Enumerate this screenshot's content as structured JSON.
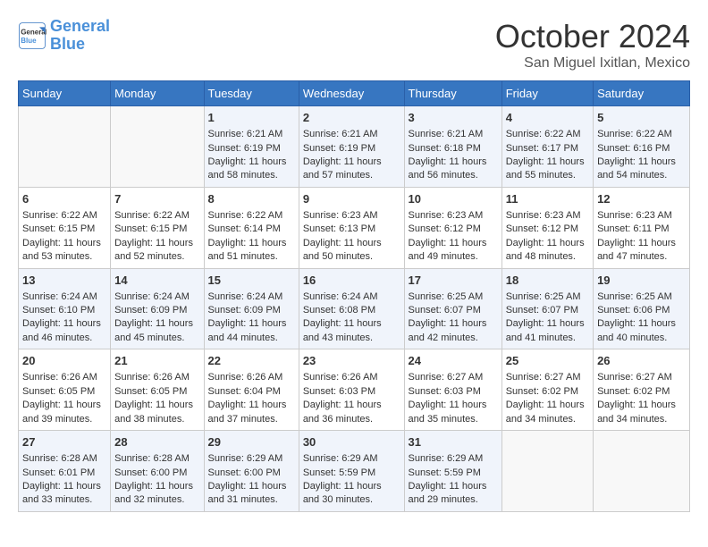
{
  "header": {
    "logo_line1": "General",
    "logo_line2": "Blue",
    "month": "October 2024",
    "location": "San Miguel Ixitlan, Mexico"
  },
  "weekdays": [
    "Sunday",
    "Monday",
    "Tuesday",
    "Wednesday",
    "Thursday",
    "Friday",
    "Saturday"
  ],
  "weeks": [
    [
      {
        "day": "",
        "sunrise": "",
        "sunset": "",
        "daylight": ""
      },
      {
        "day": "",
        "sunrise": "",
        "sunset": "",
        "daylight": ""
      },
      {
        "day": "1",
        "sunrise": "Sunrise: 6:21 AM",
        "sunset": "Sunset: 6:19 PM",
        "daylight": "Daylight: 11 hours and 58 minutes."
      },
      {
        "day": "2",
        "sunrise": "Sunrise: 6:21 AM",
        "sunset": "Sunset: 6:19 PM",
        "daylight": "Daylight: 11 hours and 57 minutes."
      },
      {
        "day": "3",
        "sunrise": "Sunrise: 6:21 AM",
        "sunset": "Sunset: 6:18 PM",
        "daylight": "Daylight: 11 hours and 56 minutes."
      },
      {
        "day": "4",
        "sunrise": "Sunrise: 6:22 AM",
        "sunset": "Sunset: 6:17 PM",
        "daylight": "Daylight: 11 hours and 55 minutes."
      },
      {
        "day": "5",
        "sunrise": "Sunrise: 6:22 AM",
        "sunset": "Sunset: 6:16 PM",
        "daylight": "Daylight: 11 hours and 54 minutes."
      }
    ],
    [
      {
        "day": "6",
        "sunrise": "Sunrise: 6:22 AM",
        "sunset": "Sunset: 6:15 PM",
        "daylight": "Daylight: 11 hours and 53 minutes."
      },
      {
        "day": "7",
        "sunrise": "Sunrise: 6:22 AM",
        "sunset": "Sunset: 6:15 PM",
        "daylight": "Daylight: 11 hours and 52 minutes."
      },
      {
        "day": "8",
        "sunrise": "Sunrise: 6:22 AM",
        "sunset": "Sunset: 6:14 PM",
        "daylight": "Daylight: 11 hours and 51 minutes."
      },
      {
        "day": "9",
        "sunrise": "Sunrise: 6:23 AM",
        "sunset": "Sunset: 6:13 PM",
        "daylight": "Daylight: 11 hours and 50 minutes."
      },
      {
        "day": "10",
        "sunrise": "Sunrise: 6:23 AM",
        "sunset": "Sunset: 6:12 PM",
        "daylight": "Daylight: 11 hours and 49 minutes."
      },
      {
        "day": "11",
        "sunrise": "Sunrise: 6:23 AM",
        "sunset": "Sunset: 6:12 PM",
        "daylight": "Daylight: 11 hours and 48 minutes."
      },
      {
        "day": "12",
        "sunrise": "Sunrise: 6:23 AM",
        "sunset": "Sunset: 6:11 PM",
        "daylight": "Daylight: 11 hours and 47 minutes."
      }
    ],
    [
      {
        "day": "13",
        "sunrise": "Sunrise: 6:24 AM",
        "sunset": "Sunset: 6:10 PM",
        "daylight": "Daylight: 11 hours and 46 minutes."
      },
      {
        "day": "14",
        "sunrise": "Sunrise: 6:24 AM",
        "sunset": "Sunset: 6:09 PM",
        "daylight": "Daylight: 11 hours and 45 minutes."
      },
      {
        "day": "15",
        "sunrise": "Sunrise: 6:24 AM",
        "sunset": "Sunset: 6:09 PM",
        "daylight": "Daylight: 11 hours and 44 minutes."
      },
      {
        "day": "16",
        "sunrise": "Sunrise: 6:24 AM",
        "sunset": "Sunset: 6:08 PM",
        "daylight": "Daylight: 11 hours and 43 minutes."
      },
      {
        "day": "17",
        "sunrise": "Sunrise: 6:25 AM",
        "sunset": "Sunset: 6:07 PM",
        "daylight": "Daylight: 11 hours and 42 minutes."
      },
      {
        "day": "18",
        "sunrise": "Sunrise: 6:25 AM",
        "sunset": "Sunset: 6:07 PM",
        "daylight": "Daylight: 11 hours and 41 minutes."
      },
      {
        "day": "19",
        "sunrise": "Sunrise: 6:25 AM",
        "sunset": "Sunset: 6:06 PM",
        "daylight": "Daylight: 11 hours and 40 minutes."
      }
    ],
    [
      {
        "day": "20",
        "sunrise": "Sunrise: 6:26 AM",
        "sunset": "Sunset: 6:05 PM",
        "daylight": "Daylight: 11 hours and 39 minutes."
      },
      {
        "day": "21",
        "sunrise": "Sunrise: 6:26 AM",
        "sunset": "Sunset: 6:05 PM",
        "daylight": "Daylight: 11 hours and 38 minutes."
      },
      {
        "day": "22",
        "sunrise": "Sunrise: 6:26 AM",
        "sunset": "Sunset: 6:04 PM",
        "daylight": "Daylight: 11 hours and 37 minutes."
      },
      {
        "day": "23",
        "sunrise": "Sunrise: 6:26 AM",
        "sunset": "Sunset: 6:03 PM",
        "daylight": "Daylight: 11 hours and 36 minutes."
      },
      {
        "day": "24",
        "sunrise": "Sunrise: 6:27 AM",
        "sunset": "Sunset: 6:03 PM",
        "daylight": "Daylight: 11 hours and 35 minutes."
      },
      {
        "day": "25",
        "sunrise": "Sunrise: 6:27 AM",
        "sunset": "Sunset: 6:02 PM",
        "daylight": "Daylight: 11 hours and 34 minutes."
      },
      {
        "day": "26",
        "sunrise": "Sunrise: 6:27 AM",
        "sunset": "Sunset: 6:02 PM",
        "daylight": "Daylight: 11 hours and 34 minutes."
      }
    ],
    [
      {
        "day": "27",
        "sunrise": "Sunrise: 6:28 AM",
        "sunset": "Sunset: 6:01 PM",
        "daylight": "Daylight: 11 hours and 33 minutes."
      },
      {
        "day": "28",
        "sunrise": "Sunrise: 6:28 AM",
        "sunset": "Sunset: 6:00 PM",
        "daylight": "Daylight: 11 hours and 32 minutes."
      },
      {
        "day": "29",
        "sunrise": "Sunrise: 6:29 AM",
        "sunset": "Sunset: 6:00 PM",
        "daylight": "Daylight: 11 hours and 31 minutes."
      },
      {
        "day": "30",
        "sunrise": "Sunrise: 6:29 AM",
        "sunset": "Sunset: 5:59 PM",
        "daylight": "Daylight: 11 hours and 30 minutes."
      },
      {
        "day": "31",
        "sunrise": "Sunrise: 6:29 AM",
        "sunset": "Sunset: 5:59 PM",
        "daylight": "Daylight: 11 hours and 29 minutes."
      },
      {
        "day": "",
        "sunrise": "",
        "sunset": "",
        "daylight": ""
      },
      {
        "day": "",
        "sunrise": "",
        "sunset": "",
        "daylight": ""
      }
    ]
  ]
}
